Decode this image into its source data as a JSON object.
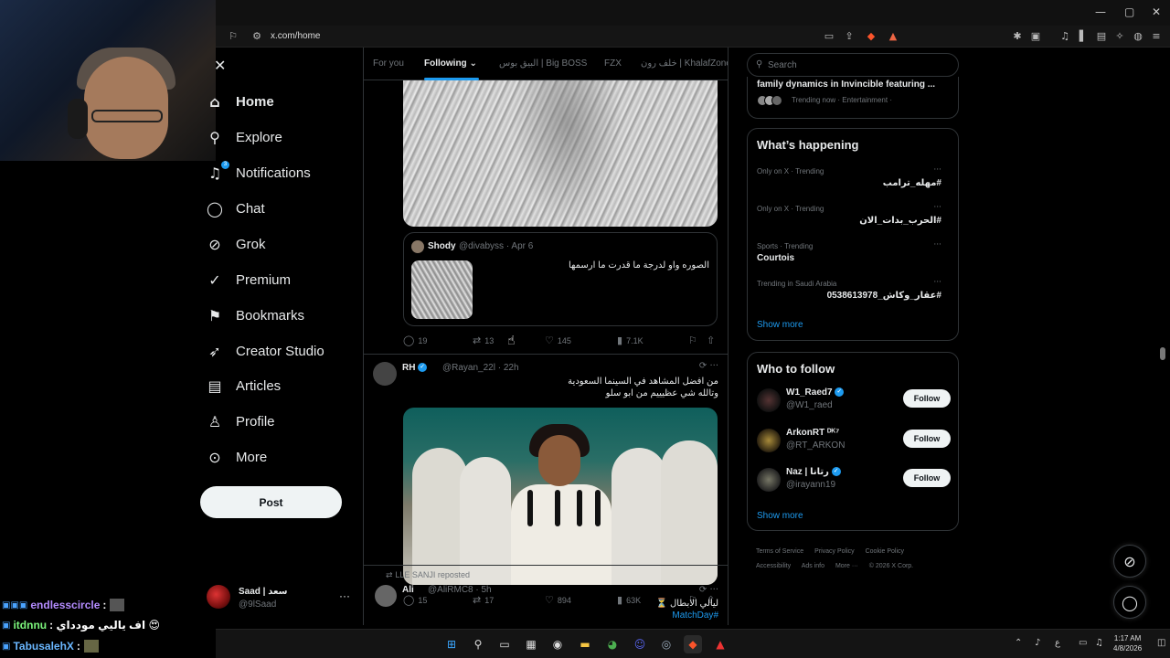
{
  "browser": {
    "url": "x.com/home",
    "window_controls": [
      "—",
      "▢",
      "✕"
    ]
  },
  "nav": {
    "items": [
      {
        "label": "Home",
        "icon": "home-icon"
      },
      {
        "label": "Explore",
        "icon": "search-icon"
      },
      {
        "label": "Notifications",
        "icon": "bell-icon",
        "badge": "3"
      },
      {
        "label": "Chat",
        "icon": "chat-icon"
      },
      {
        "label": "Grok",
        "icon": "grok-icon"
      },
      {
        "label": "Premium",
        "icon": "verified-icon"
      },
      {
        "label": "Bookmarks",
        "icon": "bookmark-icon"
      },
      {
        "label": "Creator Studio",
        "icon": "rocket-icon"
      },
      {
        "label": "Articles",
        "icon": "article-icon"
      },
      {
        "label": "Profile",
        "icon": "person-icon"
      },
      {
        "label": "More",
        "icon": "more-circle-icon"
      }
    ],
    "post_label": "Post",
    "account": {
      "name": "Saad | سعد",
      "handle": "@9lSaad"
    }
  },
  "tabs": [
    "For you",
    "Following",
    "البيق بوس | Big BOSS",
    "FZX",
    "خلف رون | KhalafZone"
  ],
  "feed": {
    "quote": {
      "name": "Shody",
      "handle_time": "@divabyss · Apr 6",
      "text": "الصوره واو لدرجة ما قدرت ما ارسمها"
    },
    "tweet1_stats": {
      "replies": "19",
      "reposts": "13",
      "likes": "145",
      "views": "7.1K"
    },
    "tweet2": {
      "name": "RH",
      "handle_time": "@Rayan_22l · 22h",
      "text_line1": "من افضل المشاهد في السينما السعودية",
      "text_line2": "وتالله شي عظيييم من ابو سلو",
      "stats": {
        "replies": "15",
        "reposts": "17",
        "likes": "894",
        "views": "63K"
      }
    },
    "tweet3": {
      "repost_label": "LLE SANJI reposted",
      "name": "Ali",
      "handle_time": "@AliRMC8 · 5h",
      "text_line1": "ليالي الابطال ⏳",
      "hashtag": "#MatchDay"
    }
  },
  "search": {
    "placeholder": "Search"
  },
  "trending_top": {
    "title": "family dynamics in Invincible featuring ...",
    "meta": "Trending now · Entertainment ·"
  },
  "whats_happening": {
    "title": "What’s happening",
    "trends": [
      {
        "context": "Only on X · Trending",
        "name": "#مهله_ترامب"
      },
      {
        "context": "Only on X · Trending",
        "name": "#الحرب_بدات_الان"
      },
      {
        "context": "Sports · Trending",
        "name": "Courtois"
      },
      {
        "context": "Trending in Saudi Arabia",
        "name": "#عقار_وكاش_0538613978"
      }
    ],
    "show_more": "Show more"
  },
  "who_to_follow": {
    "title": "Who to follow",
    "accounts": [
      {
        "name": "W1_Raed7",
        "handle": "@W1_raed",
        "button": "Follow"
      },
      {
        "name": "ArkonRT ᴰᴷ⁷",
        "handle": "@RT_ARKON",
        "button": "Follow"
      },
      {
        "name": "Naz | رتانا",
        "handle": "@irayann19",
        "button": "Follow"
      }
    ],
    "show_more": "Show more"
  },
  "footer": {
    "links": [
      "Terms of Service",
      "Privacy Policy",
      "Cookie Policy",
      "Accessibility",
      "Ads info",
      "More ···"
    ],
    "copyright": "© 2026 X Corp."
  },
  "chat_overlay": [
    {
      "user": "endlesscircle",
      "color": "#b48cff",
      "msg": ":"
    },
    {
      "user": "itdnnu",
      "color": "#7cf57c",
      "msg": ": اف ياليي مودداي 😍"
    },
    {
      "user": "TabusalehX",
      "color": "#6ab7ff",
      "msg": ":"
    }
  ],
  "clock": {
    "time": "1:17 AM",
    "date": "4/8/2026"
  },
  "colors": {
    "accent": "#1d9bf0",
    "bg": "#000000",
    "border": "#2f3336",
    "muted": "#71767b"
  }
}
